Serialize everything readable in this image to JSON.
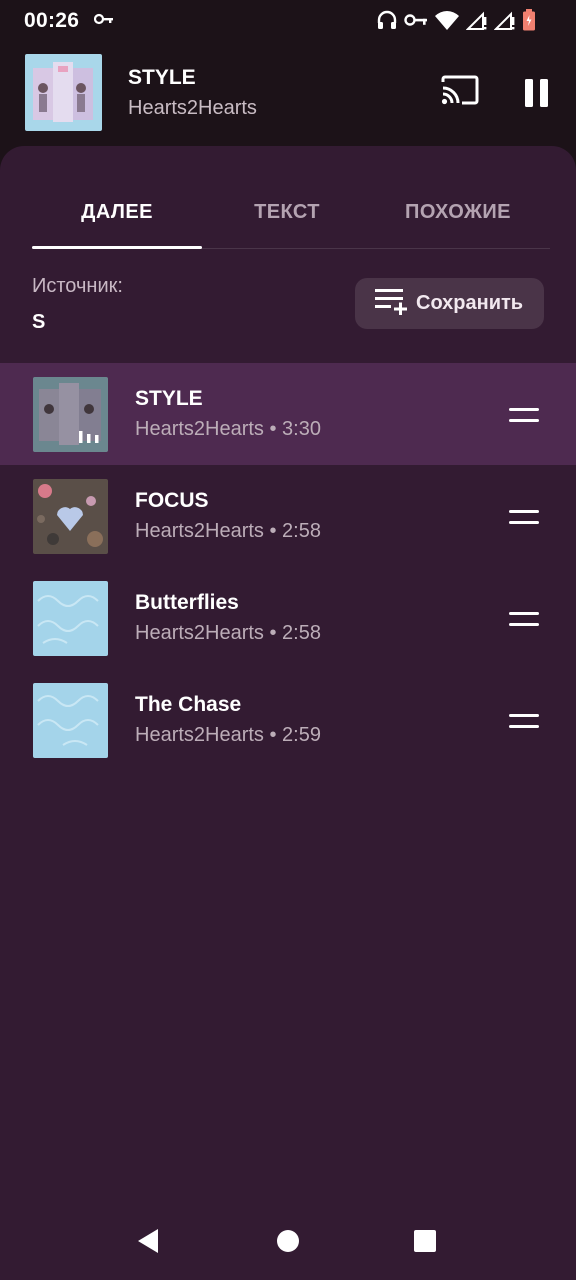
{
  "status_bar": {
    "time": "00:26"
  },
  "mini_player": {
    "title": "STYLE",
    "artist": "Hearts2Hearts"
  },
  "tabs": [
    {
      "label": "ДАЛЕЕ",
      "active": true
    },
    {
      "label": "ТЕКСТ",
      "active": false
    },
    {
      "label": "ПОХОЖИЕ",
      "active": false
    }
  ],
  "source": {
    "label": "Источник:",
    "value": "S"
  },
  "save_button": {
    "label": "Сохранить"
  },
  "queue": [
    {
      "title": "STYLE",
      "subtitle": "Hearts2Hearts • 3:30",
      "playing": true
    },
    {
      "title": "FOCUS",
      "subtitle": "Hearts2Hearts • 2:58",
      "playing": false
    },
    {
      "title": "Butterflies",
      "subtitle": "Hearts2Hearts • 2:58",
      "playing": false
    },
    {
      "title": "The Chase",
      "subtitle": "Hearts2Hearts • 2:59",
      "playing": false
    }
  ],
  "colors": {
    "sheet_background": "#331b32",
    "playing_row": "#4e2a50",
    "accent_text": "#ffffff"
  }
}
